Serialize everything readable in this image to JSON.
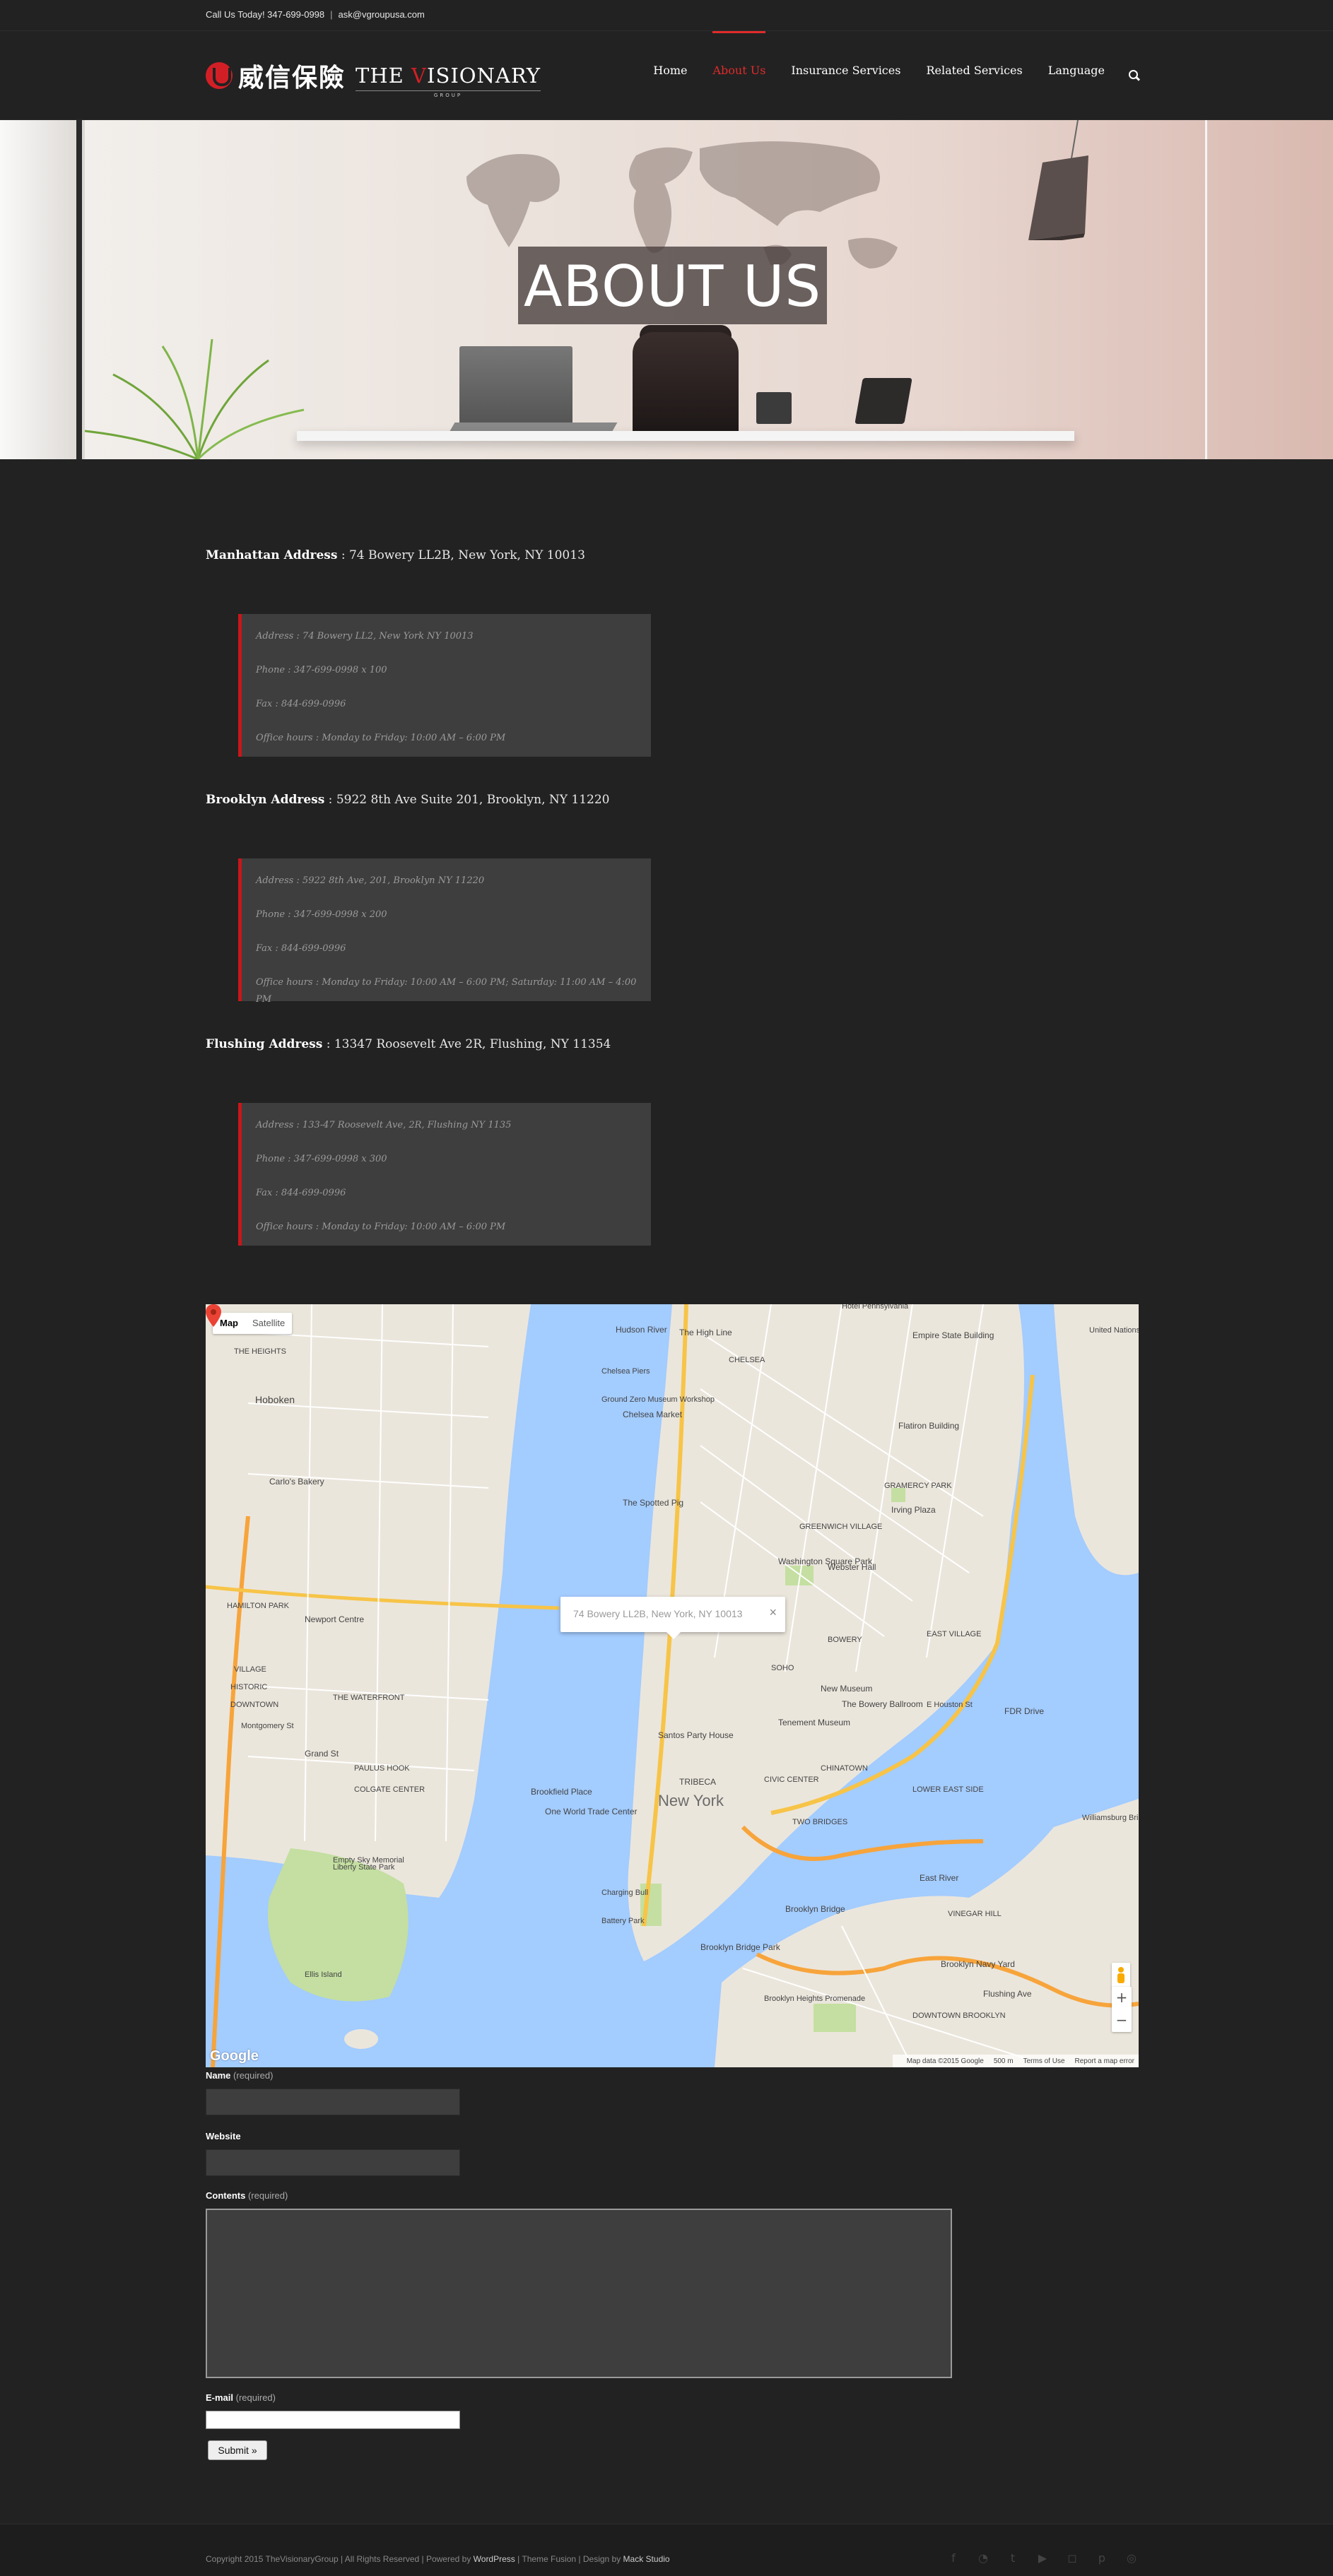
{
  "topbar": {
    "phone": "Call Us Today! 347-699-0998",
    "separator": "|",
    "email": "ask@vgroupusa.com"
  },
  "logo": {
    "chinese": "威信保險",
    "english_prefix": "THE ",
    "english_v": "V",
    "english_rest": "ISIONARY",
    "english_sub": "GROUP"
  },
  "nav": {
    "items": [
      {
        "label": "Home",
        "active": false
      },
      {
        "label": "About Us",
        "active": true
      },
      {
        "label": "Insurance Services",
        "active": false
      },
      {
        "label": "Related Services",
        "active": false
      },
      {
        "label": "Language",
        "active": false
      }
    ],
    "search_icon": "search-icon"
  },
  "hero": {
    "title": "ABOUT US"
  },
  "offices": [
    {
      "name": "Manhattan Address",
      "address": " : 74 Bowery LL2B, New York, NY 10013",
      "lines": [
        "Address : 74 Bowery LL2, New York NY 10013",
        "Phone : 347-699-0998 x 100",
        "Fax : 844-699-0996",
        "Office hours : Monday to Friday: 10:00 AM – 6:00 PM"
      ]
    },
    {
      "name": "Brooklyn Address",
      "address": " : 5922 8th Ave Suite 201, Brooklyn, NY 11220",
      "lines": [
        "Address : 5922 8th Ave, 201, Brooklyn NY 11220",
        "Phone : 347-699-0998 x 200",
        "Fax : 844-699-0996",
        "Office hours : Monday to Friday: 10:00 AM – 6:00 PM; Saturday: 11:00 AM – 4:00 PM"
      ]
    },
    {
      "name": "Flushing Address",
      "address": " : 13347 Roosevelt Ave 2R, Flushing, NY 11354",
      "lines": [
        "Address : 133-47 Roosevelt Ave, 2R, Flushing NY 1135",
        "Phone : 347-699-0998 x 300",
        "Fax : 844-699-0996",
        "Office hours : Monday to Friday: 10:00 AM – 6:00 PM"
      ]
    }
  ],
  "map": {
    "type_map": "Map",
    "type_satellite": "Satellite",
    "info_text": "74 Bowery LL2B, New York, NY 10013",
    "info_close": "×",
    "zoom_in": "+",
    "zoom_out": "−",
    "google": "Google",
    "footer": {
      "data": "Map data ©2015 Google",
      "scale": "500 m",
      "terms": "Terms of Use",
      "report": "Report a map error"
    },
    "labels": [
      {
        "text": "Hoboken"
      },
      {
        "text": "Carlo's Bakery"
      },
      {
        "text": "HAMILTON PARK"
      },
      {
        "text": "Newport Centre"
      },
      {
        "text": "VILLAGE"
      },
      {
        "text": "HISTORIC"
      },
      {
        "text": "DOWNTOWN"
      },
      {
        "text": "THE WATERFRONT"
      },
      {
        "text": "PAULUS HOOK"
      },
      {
        "text": "COLGATE CENTER"
      },
      {
        "text": "Empty Sky Memorial"
      },
      {
        "text": "Liberty State Park"
      },
      {
        "text": "Ellis Island"
      },
      {
        "text": "THE HEIGHTS"
      },
      {
        "text": "Chelsea Market"
      },
      {
        "text": "The High Line"
      },
      {
        "text": "CHELSEA"
      },
      {
        "text": "Empire State Building"
      },
      {
        "text": "Flatiron Building"
      },
      {
        "text": "The Spotted Pig"
      },
      {
        "text": "GREENWICH VILLAGE"
      },
      {
        "text": "Washington Square Park"
      },
      {
        "text": "Webster Hall"
      },
      {
        "text": "Irving Plaza"
      },
      {
        "text": "GRAMERCY PARK"
      },
      {
        "text": "EAST VILLAGE"
      },
      {
        "text": "BOWERY"
      },
      {
        "text": "SOHO"
      },
      {
        "text": "New Museum"
      },
      {
        "text": "The Bowery Ballroom"
      },
      {
        "text": "Tenement Museum"
      },
      {
        "text": "Santos Party House"
      },
      {
        "text": "TRIBECA"
      },
      {
        "text": "CHINATOWN"
      },
      {
        "text": "LOWER EAST SIDE"
      },
      {
        "text": "CIVIC CENTER"
      },
      {
        "text": "New York"
      },
      {
        "text": "TWO BRIDGES"
      },
      {
        "text": "Brookfield Place"
      },
      {
        "text": "One World Trade Center"
      },
      {
        "text": "Charging Bull"
      },
      {
        "text": "Battery Park"
      },
      {
        "text": "Brooklyn Bridge Park"
      },
      {
        "text": "VINEGAR HILL"
      },
      {
        "text": "Brooklyn Navy Yard"
      },
      {
        "text": "Brooklyn Heights Promenade"
      },
      {
        "text": "DOWNTOWN BROOKLYN"
      },
      {
        "text": "Flushing Ave"
      },
      {
        "text": "East River"
      },
      {
        "text": "Hudson River"
      },
      {
        "text": "Chelsea Piers"
      },
      {
        "text": "Ground Zero Museum Workshop"
      },
      {
        "text": "Hotel Pennsylvania"
      },
      {
        "text": "United Nations Headquarters"
      },
      {
        "text": "Grand St"
      },
      {
        "text": "Montgomery St"
      },
      {
        "text": "Williamsburg Bridge"
      },
      {
        "text": "Brooklyn Bridge"
      },
      {
        "text": "E Houston St"
      },
      {
        "text": "FDR Drive"
      }
    ]
  },
  "form": {
    "name_label": "Name",
    "name_req": "(required)",
    "website_label": "Website",
    "contents_label": "Contents",
    "contents_req": "(required)",
    "email_label": "E-mail",
    "email_req": "(required)",
    "submit": "Submit »"
  },
  "footer": {
    "copy_prefix": "Copyright 2015 TheVisionaryGroup | All Rights Reserved | Powered by ",
    "wordpress": "WordPress",
    "theme": " | Theme Fusion | Design by ",
    "designer": "Mack Studio",
    "social": [
      "facebook-icon",
      "rss-icon",
      "twitter-icon",
      "youtube-icon",
      "instagram-icon",
      "pinterest-icon",
      "dribbble-icon"
    ]
  }
}
